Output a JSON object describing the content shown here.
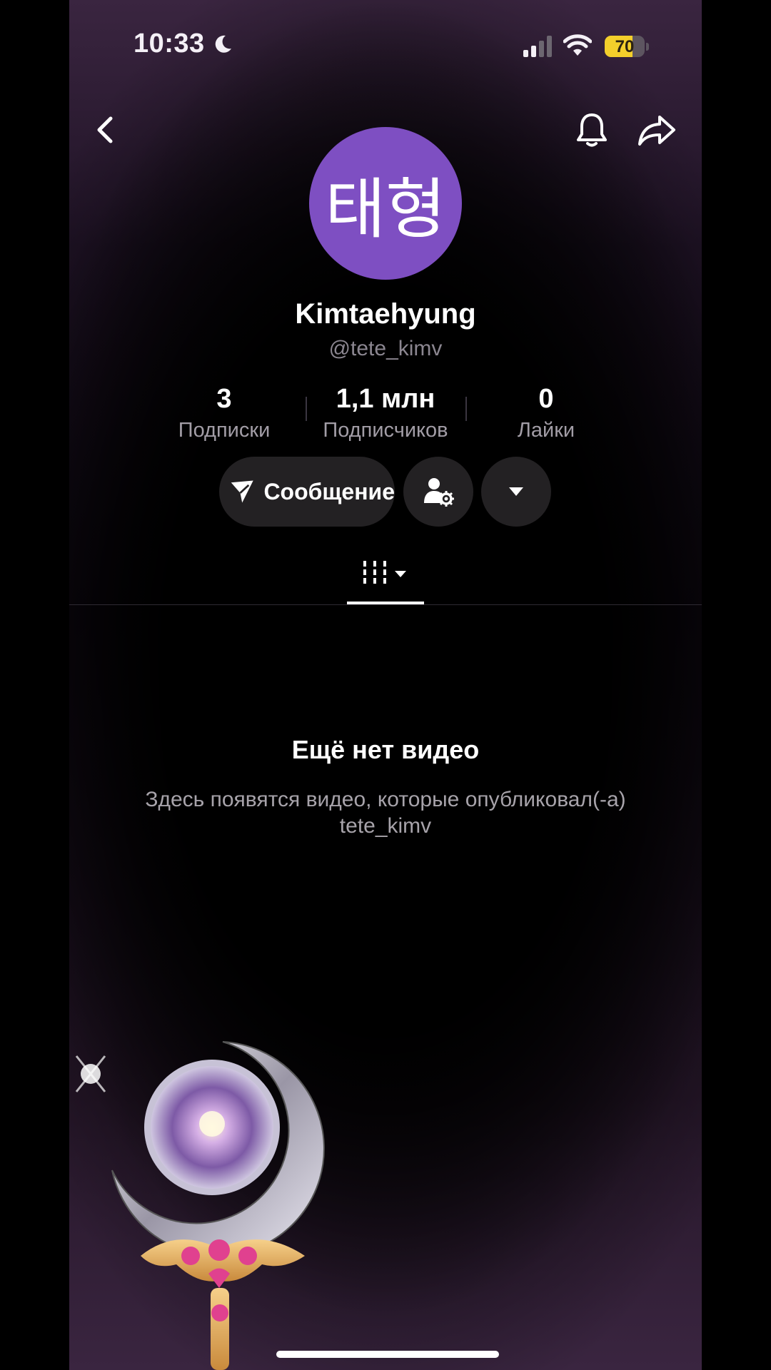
{
  "status_bar": {
    "time": "10:33",
    "battery_level": "70",
    "battery_fraction": 0.7
  },
  "header": {
    "back_icon": "chevron-left-icon",
    "bell_icon": "bell-icon",
    "share_icon": "share-arrow-icon"
  },
  "profile": {
    "avatar_text": "태형",
    "avatar_color": "#7e4fc2",
    "username": "Kimtaehyung",
    "handle": "@tete_kimv"
  },
  "stats": [
    {
      "value": "3",
      "label": "Подписки"
    },
    {
      "value": "1,1 млн",
      "label": "Подписчиков"
    },
    {
      "value": "0",
      "label": "Лайки"
    }
  ],
  "actions": {
    "message_label": "Сообщение",
    "message_icon": "send-icon",
    "follow_settings_icon": "user-gear-icon",
    "more_icon": "caret-down-icon"
  },
  "tabs": {
    "videos_icon": "grid-columns-icon"
  },
  "empty_state": {
    "title": "Ещё нет видео",
    "description": "Здесь появятся видео, которые опубликовал(-а) tete_kimv"
  }
}
